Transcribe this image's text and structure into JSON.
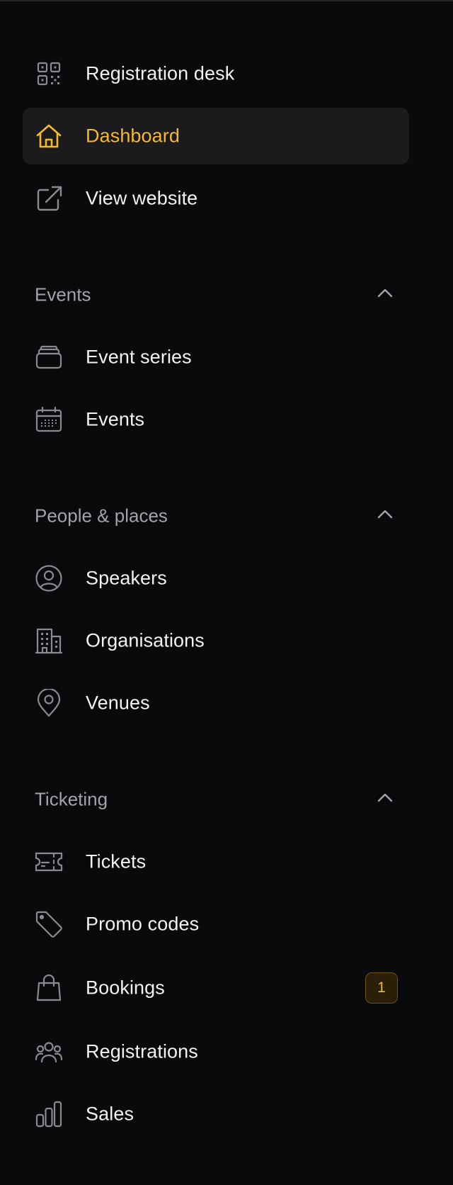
{
  "colors": {
    "background": "#0a0a0c",
    "active_background": "#1b1b1d",
    "accent": "#f5b82e",
    "text": "#f2f2f4",
    "section_text": "#a2a2a8",
    "icon": "#8a8a90"
  },
  "nav": {
    "top_items": [
      {
        "label": "Registration desk",
        "icon": "qr-code-icon"
      },
      {
        "label": "Dashboard",
        "icon": "home-icon",
        "active": true
      },
      {
        "label": "View website",
        "icon": "external-link-icon"
      }
    ],
    "sections": [
      {
        "label": "Events",
        "expanded": true,
        "items": [
          {
            "label": "Event series",
            "icon": "stack-icon"
          },
          {
            "label": "Events",
            "icon": "calendar-icon"
          }
        ]
      },
      {
        "label": "People & places",
        "expanded": true,
        "items": [
          {
            "label": "Speakers",
            "icon": "user-circle-icon"
          },
          {
            "label": "Organisations",
            "icon": "building-icon"
          },
          {
            "label": "Venues",
            "icon": "map-pin-icon"
          }
        ]
      },
      {
        "label": "Ticketing",
        "expanded": true,
        "items": [
          {
            "label": "Tickets",
            "icon": "ticket-icon"
          },
          {
            "label": "Promo codes",
            "icon": "tag-icon"
          },
          {
            "label": "Bookings",
            "icon": "shopping-bag-icon",
            "badge": "1"
          },
          {
            "label": "Registrations",
            "icon": "users-icon"
          },
          {
            "label": "Sales",
            "icon": "bar-chart-icon"
          }
        ]
      }
    ]
  }
}
